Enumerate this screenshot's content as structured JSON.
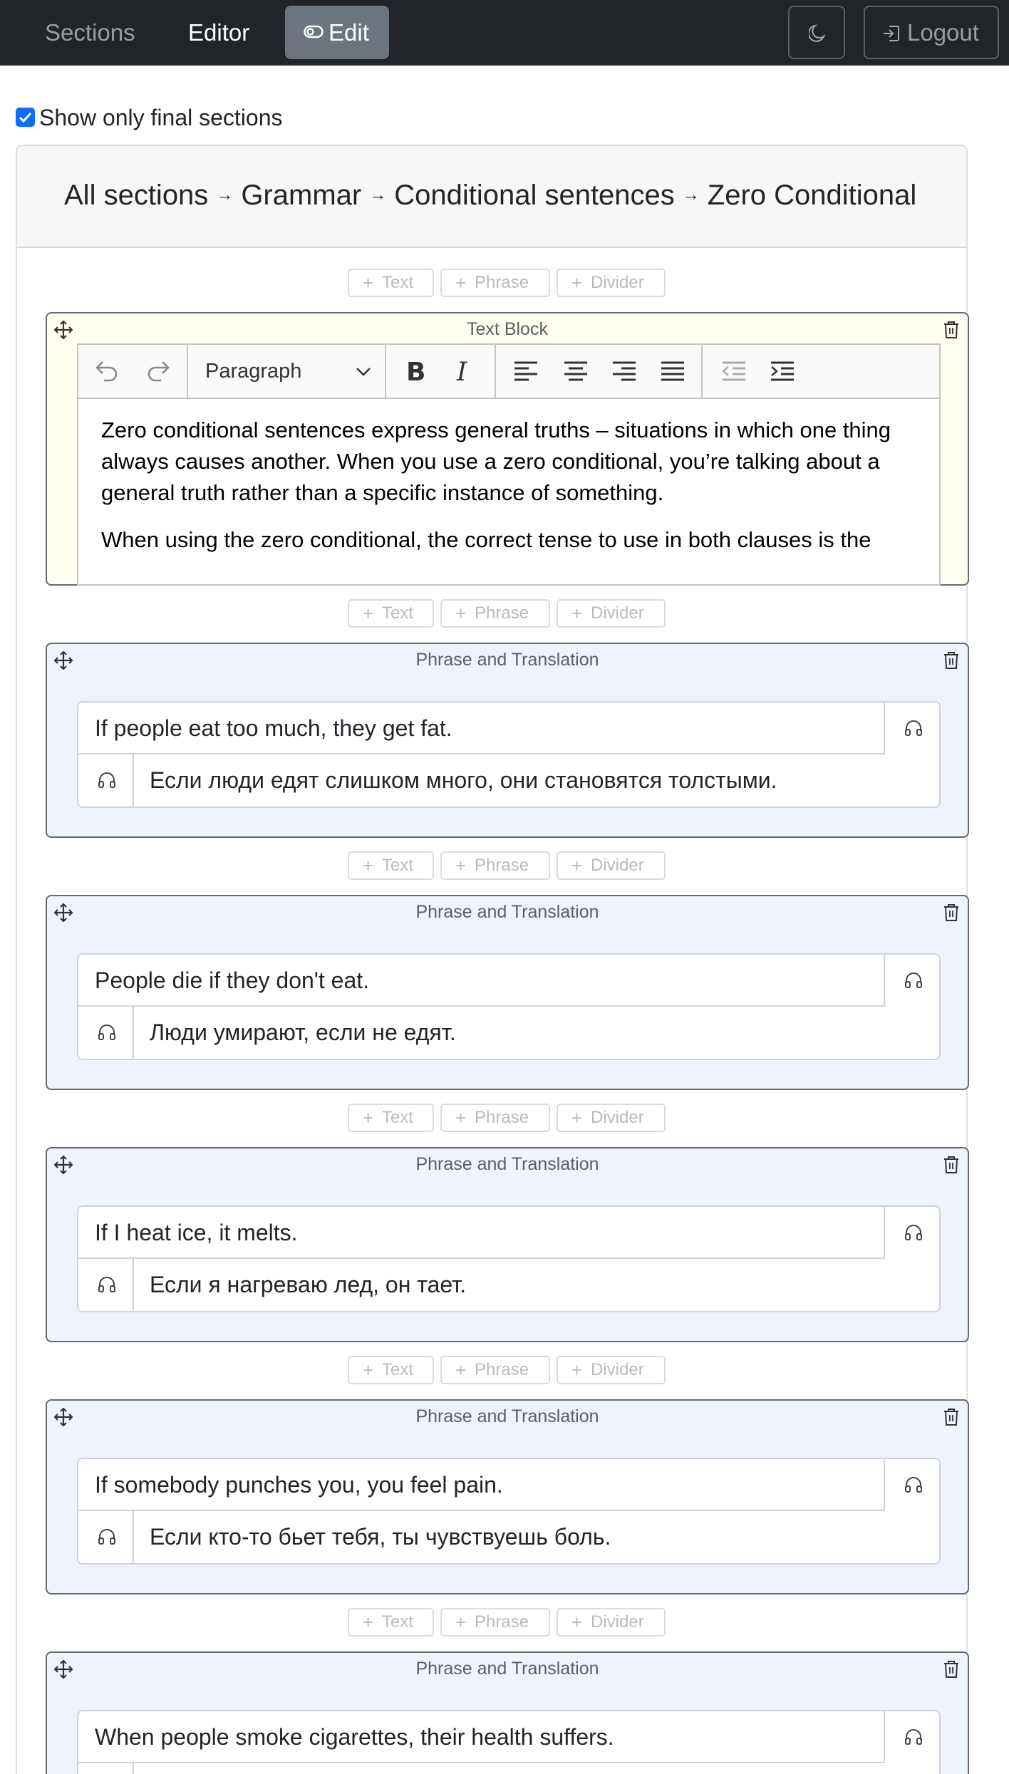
{
  "nav": {
    "sections": "Sections",
    "editor": "Editor",
    "edit": "Edit",
    "logout": "Logout"
  },
  "filter": {
    "label": "Show only final sections",
    "checked": true
  },
  "breadcrumb": [
    "All sections",
    "Grammar",
    "Conditional sentences",
    "Zero Conditional"
  ],
  "add_buttons": {
    "text": "Text",
    "phrase": "Phrase",
    "divider": "Divider"
  },
  "text_block": {
    "title": "Text Block",
    "format": "Paragraph",
    "paragraphs": [
      "Zero conditional sentences express general truths – situations in which one thing always causes another. When you use a zero conditional, you’re talking about a general truth rather than a specific instance of something.",
      "When using the zero conditional, the correct tense to use in both clauses is the"
    ]
  },
  "phrase_blocks": [
    {
      "title": "Phrase and Translation",
      "phrase": "If people eat too much, they get fat.",
      "translation": "Если люди едят слишком много, они становятся толстыми."
    },
    {
      "title": "Phrase and Translation",
      "phrase": "People die if they don't eat.",
      "translation": "Люди умирают, если не едят."
    },
    {
      "title": "Phrase and Translation",
      "phrase": "If I heat ice, it melts.",
      "translation": "Если я нагреваю лед, он тает."
    },
    {
      "title": "Phrase and Translation",
      "phrase": "If somebody punches you, you feel pain.",
      "translation": "Если кто-то бьет тебя, ты чувствуешь боль."
    },
    {
      "title": "Phrase and Translation",
      "phrase": "When people smoke cigarettes, their health suffers.",
      "translation": ""
    }
  ],
  "icons": {
    "edit": "toggle-icon",
    "theme": "moon-icon",
    "logout": "logout-icon",
    "move": "move-icon",
    "delete": "trash-icon",
    "audio": "headphones-icon"
  },
  "colors": {
    "navbar": "#212529",
    "edit_button": "#6c757d",
    "checkbox": "#0d6efd",
    "text_block_bg": "#fffef0",
    "phrase_block_bg": "#eef3fc"
  }
}
